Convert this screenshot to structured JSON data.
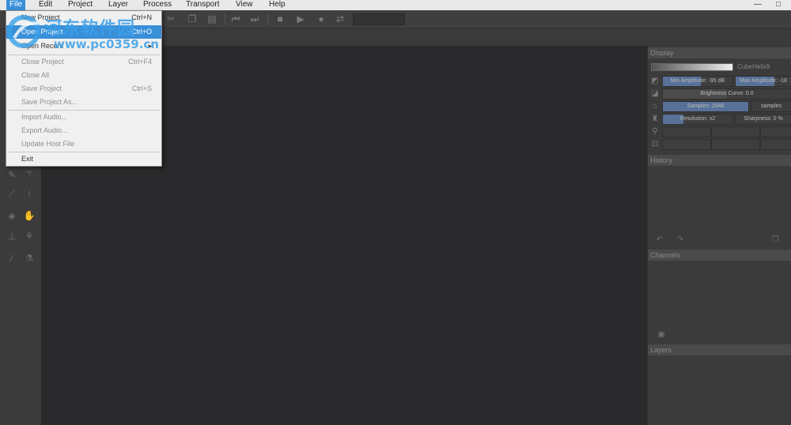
{
  "menubar": {
    "items": [
      {
        "label": "File",
        "active": true
      },
      {
        "label": "Edit"
      },
      {
        "label": "Project"
      },
      {
        "label": "Layer"
      },
      {
        "label": "Process"
      },
      {
        "label": "Transport"
      },
      {
        "label": "View"
      },
      {
        "label": "Help"
      }
    ],
    "minimize_glyph": "—",
    "maximize_glyph": "□"
  },
  "file_menu": {
    "items": [
      {
        "label": "New Project",
        "shortcut": "Ctrl+N",
        "disabled": false
      },
      {
        "label": "Open Project",
        "shortcut": "Ctrl+O",
        "disabled": false,
        "highlight": true
      },
      {
        "label": "Open Recent",
        "shortcut": "",
        "disabled": false
      },
      {
        "label": "Close Project",
        "shortcut": "Ctrl+F4",
        "disabled": true
      },
      {
        "label": "Close All",
        "shortcut": "",
        "disabled": true
      },
      {
        "label": "Save Project",
        "shortcut": "Ctrl+S",
        "disabled": true
      },
      {
        "label": "Save Project As...",
        "shortcut": "",
        "disabled": true
      },
      {
        "label": "Import Audio...",
        "shortcut": "",
        "disabled": true
      },
      {
        "label": "Export Audio...",
        "shortcut": "",
        "disabled": true
      },
      {
        "label": "Update Host File",
        "shortcut": "",
        "disabled": true
      },
      {
        "label": "Exit",
        "shortcut": "",
        "disabled": false
      }
    ]
  },
  "watermark": {
    "text_cn": "河东软件园",
    "url": "www.pc0359.cn"
  },
  "toolbar": {
    "icons": [
      "cut-icon",
      "copy-icon",
      "paste-icon",
      "skip-start-icon",
      "skip-end-icon",
      "stop-icon",
      "play-icon",
      "record-icon",
      "loop-icon"
    ]
  },
  "display_panel": {
    "title": "Display",
    "colormap": "CubeHelix9",
    "min_amplitude": "Min Amplitude: -95 dB",
    "max_amplitude": "Max Amplitude: -18",
    "brightness": "Brightness Curve: 0.0",
    "samples_left": "Samples: 2048",
    "samples_right": "samples",
    "resolution": "Resolution: x2",
    "sharpness": "Sharpness: 0 %"
  },
  "history_panel": {
    "title": "History"
  },
  "channels_panel": {
    "title": "Channels"
  },
  "layers_panel": {
    "title": "Layers"
  },
  "colors": {
    "accent": "#3a8fd9",
    "background": "#2a2a2c",
    "panel": "#3b3b3b",
    "slider_fill": "#5c7aa8"
  }
}
